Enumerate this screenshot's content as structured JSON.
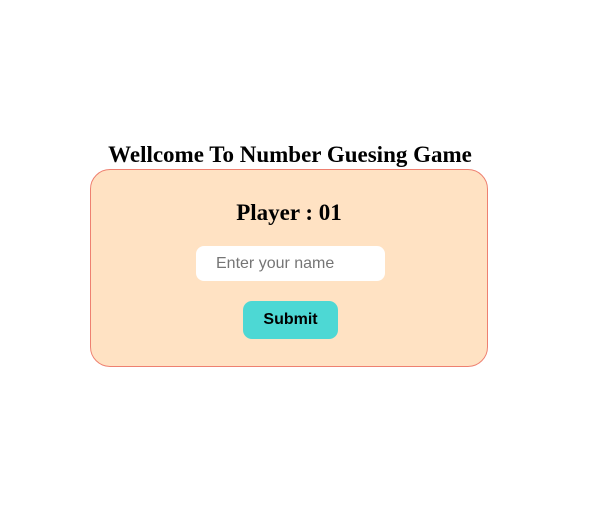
{
  "header": {
    "title": "Wellcome To Number Guesing Game"
  },
  "player_card": {
    "player_label": "Player : 01",
    "name_input": {
      "value": "",
      "placeholder": "Enter your name"
    },
    "submit_label": "Submit"
  },
  "colors": {
    "card_background": "#ffe2c3",
    "card_border": "#ee8070",
    "submit_button": "#4dd8d4",
    "page_background": "#ffffff"
  }
}
